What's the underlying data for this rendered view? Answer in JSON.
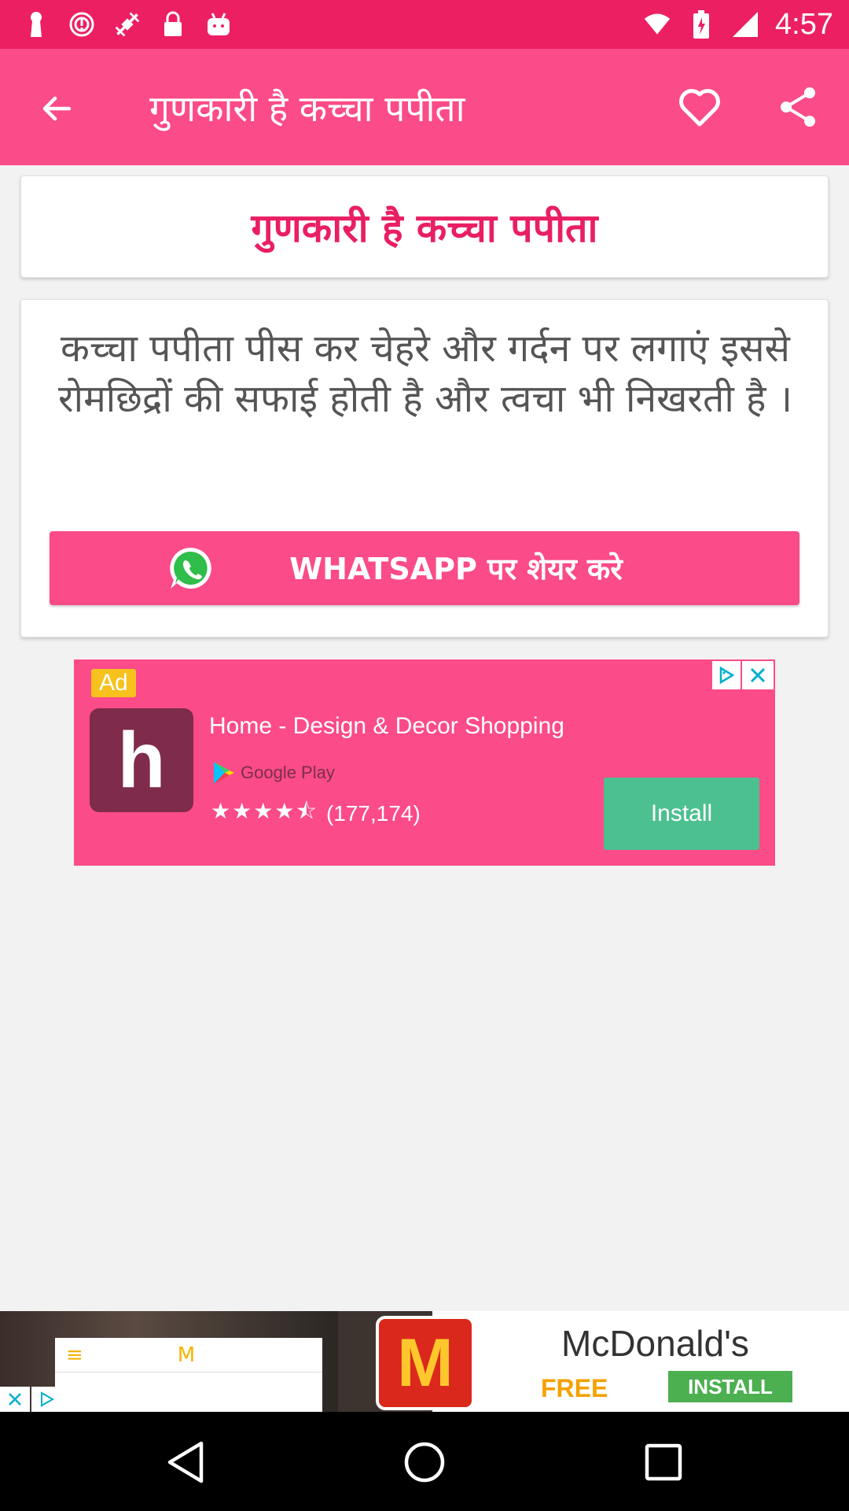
{
  "status_bar": {
    "time": "4:57",
    "left_icons": [
      "keyhole-icon",
      "alert-icon",
      "fake-gps-icon",
      "lock-icon",
      "android-icon"
    ],
    "right_icons": [
      "wifi-icon",
      "battery-icon",
      "signal-icon"
    ]
  },
  "toolbar": {
    "title": "गुणकारी है कच्चा पपीता",
    "back_icon": "arrow-left-icon",
    "favorite_icon": "heart-outline-icon",
    "share_icon": "share-icon"
  },
  "article": {
    "heading": "गुणकारी है कच्चा पपीता",
    "body": "कच्चा पपीता पीस कर चेहरे और गर्दन पर लगाएं इससे रोमछिद्रों की सफाई होती है और त्वचा भी निखरती है ।",
    "whatsapp_button_label": "WHATSAPP पर शेयर करे"
  },
  "ad": {
    "badge": "Ad",
    "logo_letter": "h",
    "title": "Home - Design & Decor Shopping",
    "store": "Google Play",
    "stars": "★★★★⯪",
    "rating_count": "(177,174)",
    "install_label": "Install"
  },
  "banner": {
    "brand": "McDonald's",
    "logo_letter": "M",
    "free_label": "FREE",
    "install_label": "INSTALL",
    "phone_logo": "M"
  },
  "navbar": {
    "back_icon": "nav-back-icon",
    "home_icon": "nav-home-icon",
    "recents_icon": "nav-recents-icon"
  },
  "colors": {
    "status_bar": "#ec1f63",
    "toolbar": "#fb4b88",
    "accent": "#e91e63",
    "install_green": "#4cc08f"
  }
}
